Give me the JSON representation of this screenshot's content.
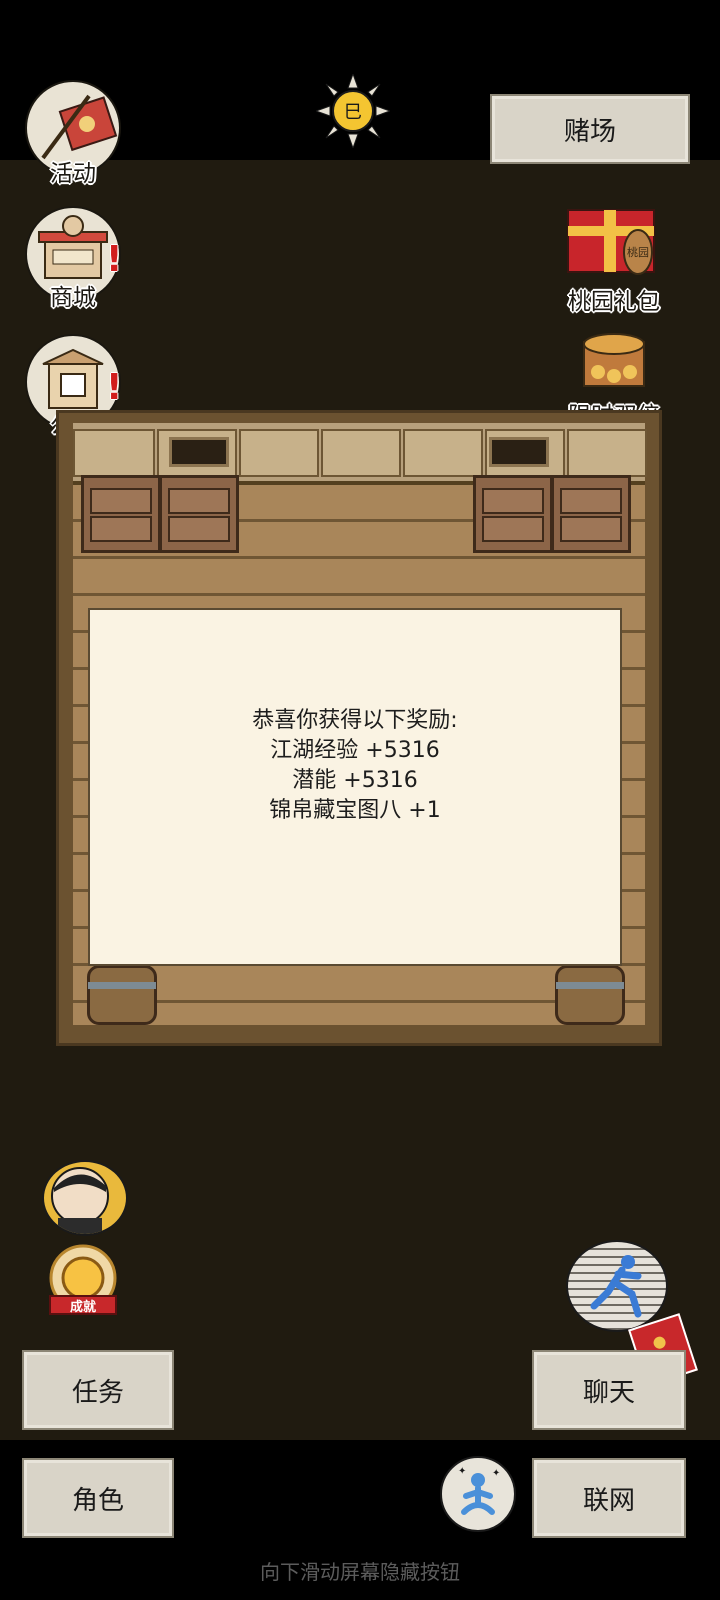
{
  "top": {
    "activity_label": "活动",
    "casino_label": "赌场"
  },
  "left_menu": {
    "shop_label": "商城",
    "notice_label": "公告"
  },
  "right_menu": {
    "gift_label": "桃园礼包",
    "double_label": "限时双倍"
  },
  "dialog": {
    "line1": "恭喜你获得以下奖励:",
    "line2": "江湖经验 +5316",
    "line3": "潜能 +5316",
    "line4": "锦帛藏宝图八 +1"
  },
  "bottom_left": {
    "achievement_label": "成就",
    "task_label": "任务",
    "role_label": "角色"
  },
  "bottom_right": {
    "chat_label": "聊天",
    "network_label": "联网"
  },
  "hint": "向下滑动屏幕隐藏按钮",
  "gift_text": "桃园"
}
